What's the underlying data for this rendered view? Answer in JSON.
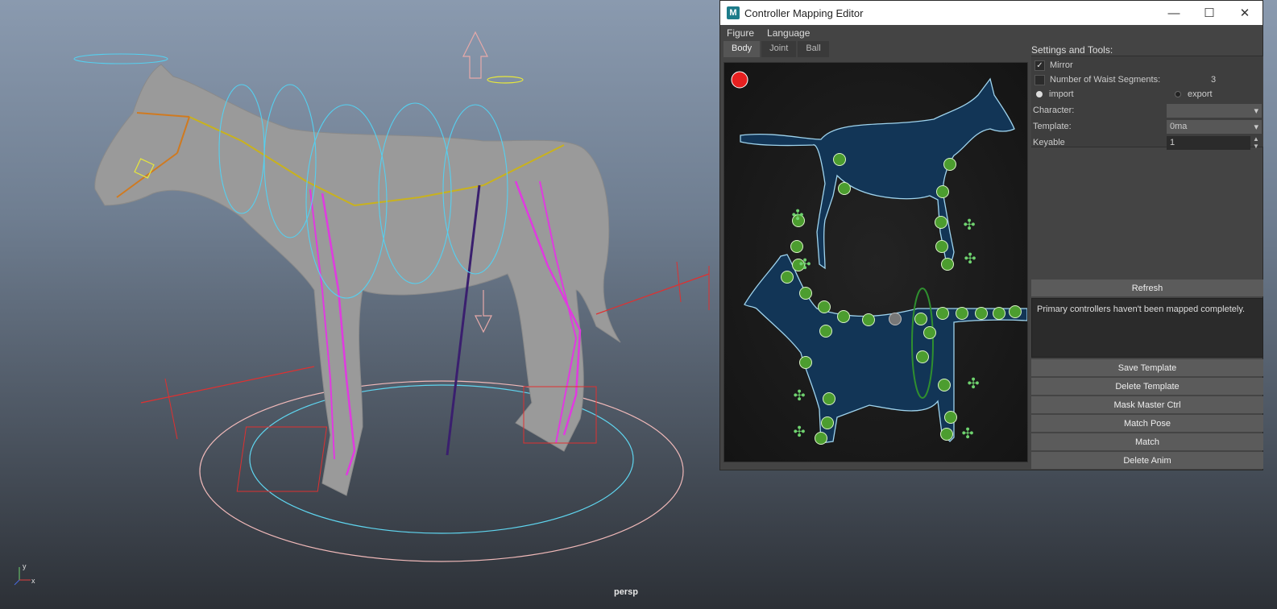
{
  "viewport": {
    "camera_label": "persp",
    "axis_x": "x",
    "axis_y": "y"
  },
  "editor": {
    "title": "Controller Mapping Editor",
    "app_icon": "M",
    "menus": [
      "Figure",
      "Language"
    ],
    "tabs": [
      "Body",
      "Joint",
      "Ball"
    ],
    "active_tab": "Body",
    "settings_label": "Settings and Tools:",
    "mirror_label": "Mirror",
    "mirror_checked": true,
    "waist_label": "Number of Waist Segments:",
    "waist_value": "3",
    "import_label": "import",
    "export_label": "export",
    "character_label": "Character:",
    "character_value": "",
    "template_label": "Template:",
    "template_value": "0ma",
    "keyable_label": "Keyable",
    "keyable_value": "1",
    "refresh_label": "Refresh",
    "message": "Primary controllers haven't been mapped completely.",
    "buttons": [
      "Save Template",
      "Delete Template",
      "Mask Master Ctrl",
      "Match Pose",
      "Match",
      "Delete Anim"
    ],
    "colors": {
      "indicator": "#e62020",
      "controller": "#4c9d2f",
      "silhouette": "#123556",
      "outline": "#9fd4ee"
    }
  }
}
